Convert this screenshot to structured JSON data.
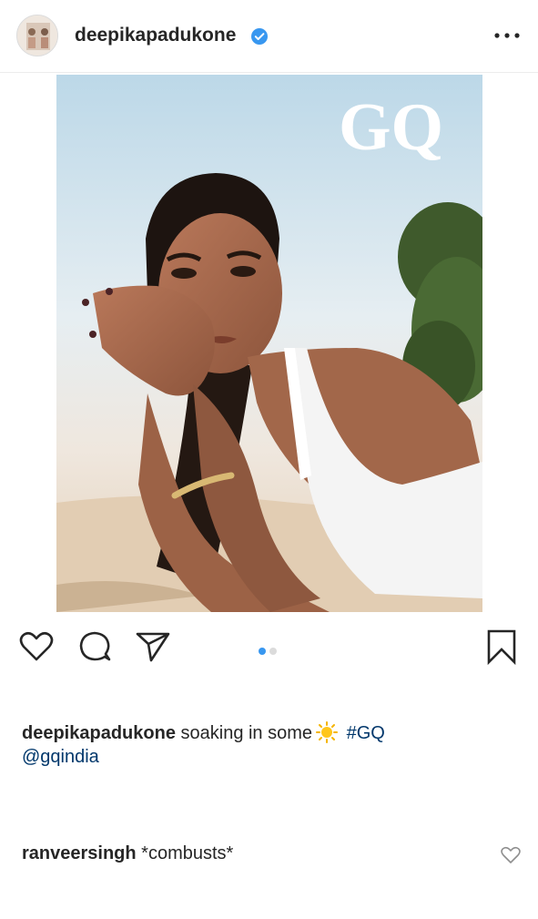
{
  "header": {
    "username": "deepikapadukone",
    "verified_icon": "verified-badge-icon",
    "more_icon": "more-options-icon"
  },
  "post": {
    "photo": {
      "description_icon": "magazine-cover-photo",
      "logo_text": "GQ"
    },
    "carousel": {
      "total": 2,
      "active": 1,
      "active_color": "#3897f0",
      "inactive_color": "#dbdbdb"
    }
  },
  "actions": {
    "like_icon": "heart-icon",
    "comment_icon": "comment-icon",
    "share_icon": "paper-plane-icon",
    "save_icon": "bookmark-icon"
  },
  "caption": {
    "username": "deepikapadukone",
    "text": "soaking in some",
    "emoji": "sun-emoji",
    "hashtag": "#GQ",
    "mention": "@gqindia"
  },
  "comment": {
    "username": "ranveersingh",
    "text": "*combusts*",
    "like_icon": "heart-outline-icon"
  },
  "colors": {
    "link": "#00376b",
    "text": "#262626",
    "verified": "#3897f0"
  }
}
